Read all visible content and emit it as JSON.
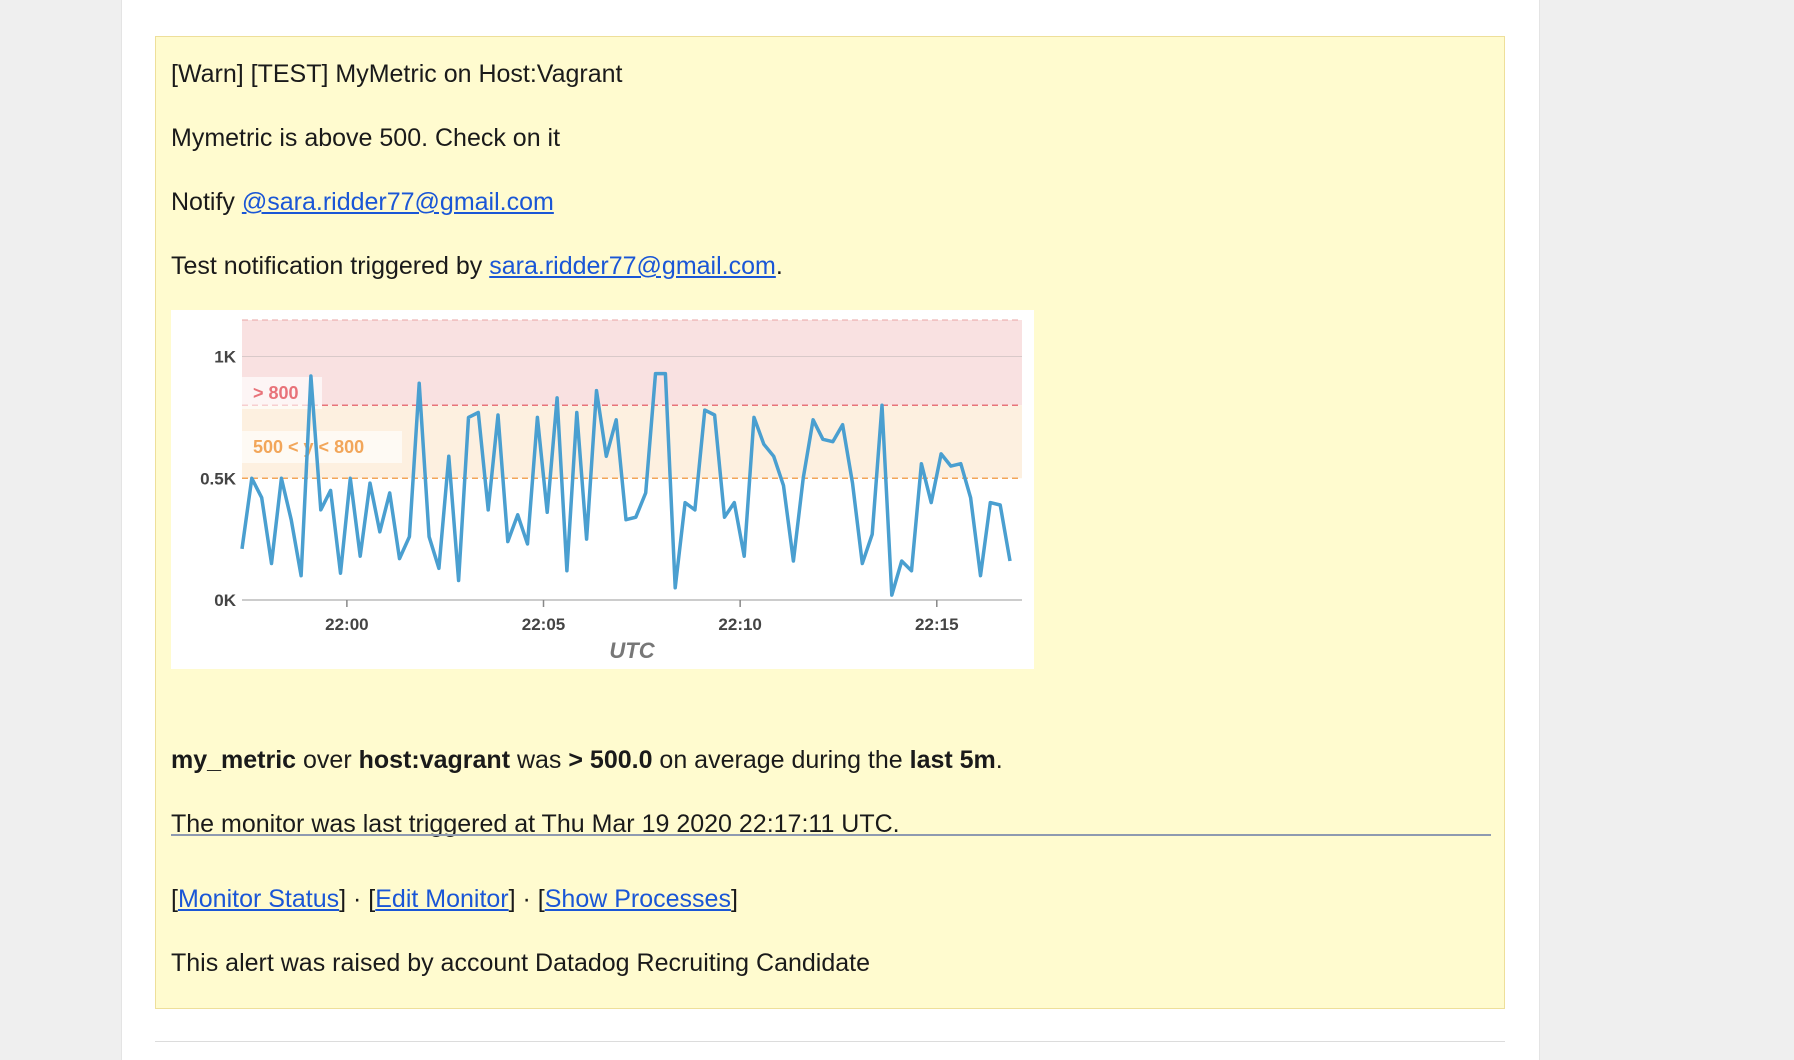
{
  "alert": {
    "title": "[Warn] [TEST] MyMetric on Host:Vagrant",
    "message": "Mymetric is above 500. Check on it",
    "notify_prefix": "Notify ",
    "notify_handle": "@sara.ridder77@gmail.com",
    "test_prefix": "Test notification triggered by ",
    "test_user": "sara.ridder77@gmail.com",
    "test_suffix": ".",
    "summary": {
      "metric": "my_metric",
      "over": " over ",
      "scope": "host:vagrant",
      "was": " was ",
      "threshold": "> 500.0",
      "on_avg": " on average during the ",
      "window": "last 5m",
      "end": "."
    },
    "last_triggered": "The monitor was last triggered at Thu Mar 19 2020 22:17:11 UTC.",
    "links": {
      "open1": "[",
      "monitor_status": "Monitor Status",
      "sep1": "] · [",
      "edit_monitor": "Edit Monitor",
      "sep2": "] · [",
      "show_processes": "Show Processes",
      "close": "]"
    },
    "raised_by": "This alert was raised by account Datadog Recruiting Candidate"
  },
  "colors": {
    "alert_bg": "#fffbcf",
    "link": "#1a56d6",
    "series": "#4a9fd0",
    "critical_band": "#f9e1e1",
    "warning_band": "#fdf0e0",
    "critical_text": "#e8737a",
    "warning_text": "#f2a65a"
  },
  "chart_data": {
    "type": "line",
    "x_start": "21:57:20",
    "x_end": "22:17:10",
    "xlabel": "UTC",
    "ylabel": "",
    "ylim": [
      0,
      1000
    ],
    "y_ticks": [
      "0K",
      "0.5K",
      "1K"
    ],
    "x_ticks": [
      "22:00",
      "22:05",
      "22:10",
      "22:15"
    ],
    "thresholds": [
      {
        "label": "> 800",
        "from": 800,
        "to": 1000,
        "kind": "critical"
      },
      {
        "label": "500 < y < 800",
        "from": 500,
        "to": 800,
        "kind": "warning"
      }
    ],
    "series": [
      {
        "values": [
          210,
          500,
          420,
          150,
          500,
          330,
          100,
          920,
          370,
          450,
          110,
          500,
          180,
          480,
          280,
          440,
          170,
          260,
          890,
          260,
          130,
          590,
          80,
          750,
          770,
          370,
          760,
          240,
          350,
          230,
          750,
          360,
          830,
          120,
          770,
          250,
          860,
          590,
          740,
          330,
          340,
          440,
          930,
          930,
          50,
          400,
          370,
          780,
          760,
          340,
          400,
          180,
          750,
          640,
          590,
          470,
          160,
          500,
          740,
          660,
          650,
          720,
          480,
          150,
          270,
          800,
          20,
          160,
          120,
          560,
          400,
          600,
          550,
          560,
          420,
          100,
          400,
          390,
          160
        ]
      }
    ]
  }
}
